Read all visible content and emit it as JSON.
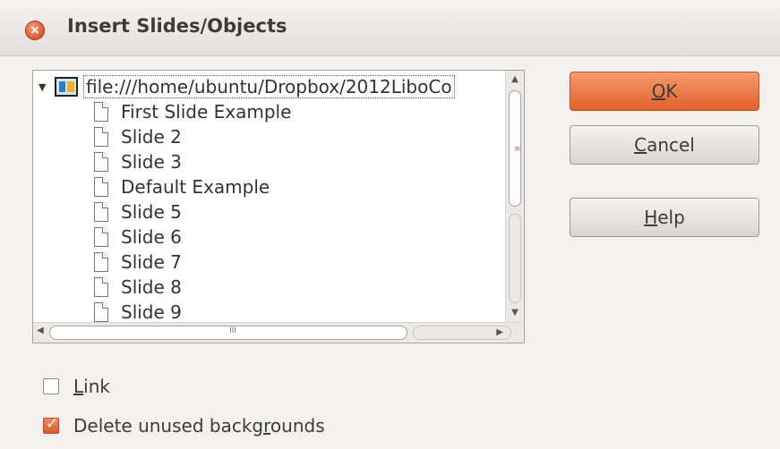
{
  "window": {
    "title": "Insert Slides/Objects",
    "close_icon": "×"
  },
  "tree": {
    "root_label": "file:///home/ubuntu/Dropbox/2012LiboCo",
    "expander_icon": "▼",
    "items": [
      {
        "label": "First Slide Example"
      },
      {
        "label": "Slide 2"
      },
      {
        "label": "Slide 3"
      },
      {
        "label": "Default Example"
      },
      {
        "label": "Slide 5"
      },
      {
        "label": "Slide 6"
      },
      {
        "label": "Slide 7"
      },
      {
        "label": "Slide 8"
      },
      {
        "label": "Slide 9"
      }
    ]
  },
  "scroll": {
    "up_arrow": "▲",
    "down_arrow": "▼",
    "left_arrow": "◀",
    "right_arrow": "▶",
    "grip": "≡",
    "hgrip": "III"
  },
  "buttons": {
    "ok": {
      "mnemonic": "O",
      "rest": "K"
    },
    "cancel": {
      "mnemonic": "C",
      "rest": "ancel"
    },
    "help": {
      "mnemonic": "H",
      "rest": "elp"
    }
  },
  "options": {
    "link": {
      "mnemonic": "L",
      "rest": "ink",
      "checked": false
    },
    "delete_unused": {
      "before": "Delete unused backg",
      "mnemonic": "r",
      "after": "ounds",
      "checked": true
    }
  },
  "colors": {
    "accent": "#e3602c"
  }
}
